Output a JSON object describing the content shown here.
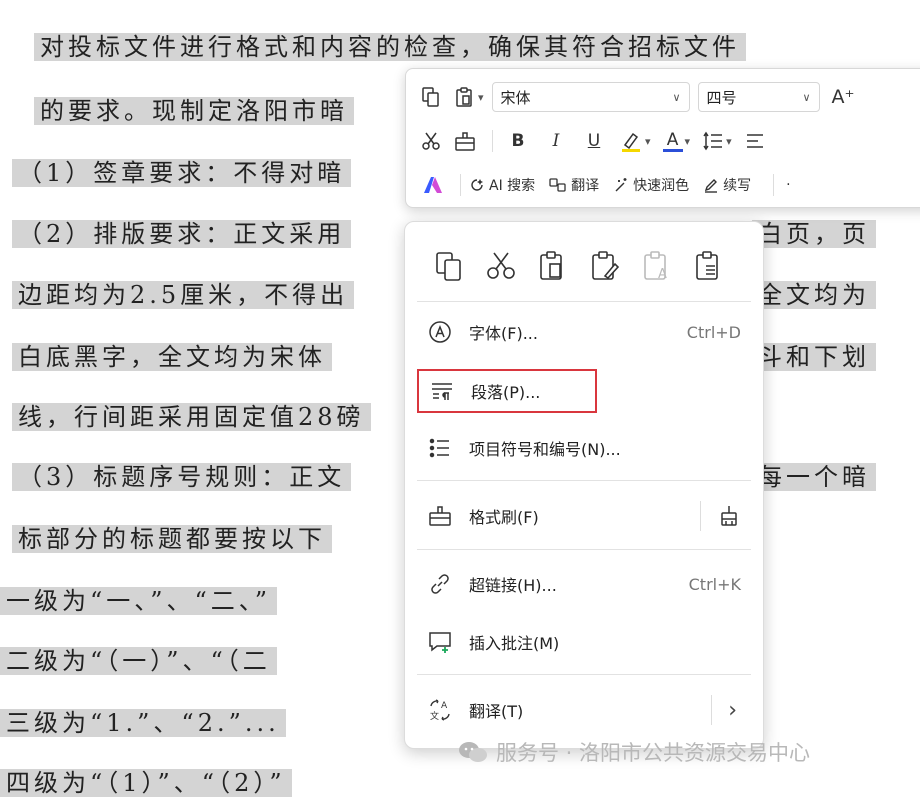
{
  "document": {
    "lines": [
      "对投标文件进行格式和内容的检查，确保其符合招标文件",
      "的要求。现制定洛阳市暗",
      "（1）签章要求：不得对暗",
      "（2）排版要求：正文采用",
      "白页，页",
      "边距均为2.5厘米，不得出",
      "全文均为",
      "白底黑字，全文均为宋体",
      "斗和下划",
      "线，行间距采用固定值28磅",
      "（3）标题序号规则：正文",
      "每一个暗",
      "标部分的标题都要按以下",
      "一级为“一、”、“二、”",
      "二级为“（一）”、“（二",
      "三级为“1.”、“2.”...",
      "四级为“（1）”、“（2）”"
    ]
  },
  "toolbar": {
    "font_name": "宋体",
    "font_size": "四号",
    "grow_font": "A⁺",
    "bold": "B",
    "italic": "I",
    "underline": "U",
    "font_color_glyph": "A",
    "ai_search": "AI 搜索",
    "translate": "翻译",
    "polish": "快速润色",
    "continue_write": "续写",
    "highlight_color": "#f5d800",
    "font_color": "#2b4fd8",
    "brand_color": "#3a5bff"
  },
  "menu": {
    "items": {
      "font": {
        "label": "字体(F)...",
        "shortcut": "Ctrl+D"
      },
      "paragraph": {
        "label": "段落(P)..."
      },
      "bullets": {
        "label": "项目符号和编号(N)..."
      },
      "format_painter": {
        "label": "格式刷(F)"
      },
      "hyperlink": {
        "label": "超链接(H)...",
        "shortcut": "Ctrl+K"
      },
      "comment": {
        "label": "插入批注(M)"
      },
      "translate": {
        "label": "翻译(T)",
        "arrow": "›"
      }
    },
    "icon_row": [
      "copy-icon",
      "cut-icon",
      "paste-icon",
      "paste-format-icon",
      "paste-text-icon",
      "paste-special-icon"
    ],
    "highlight_border_color": "#d9363e"
  },
  "watermark": {
    "text": "服务号 · 洛阳市公共资源交易中心"
  }
}
